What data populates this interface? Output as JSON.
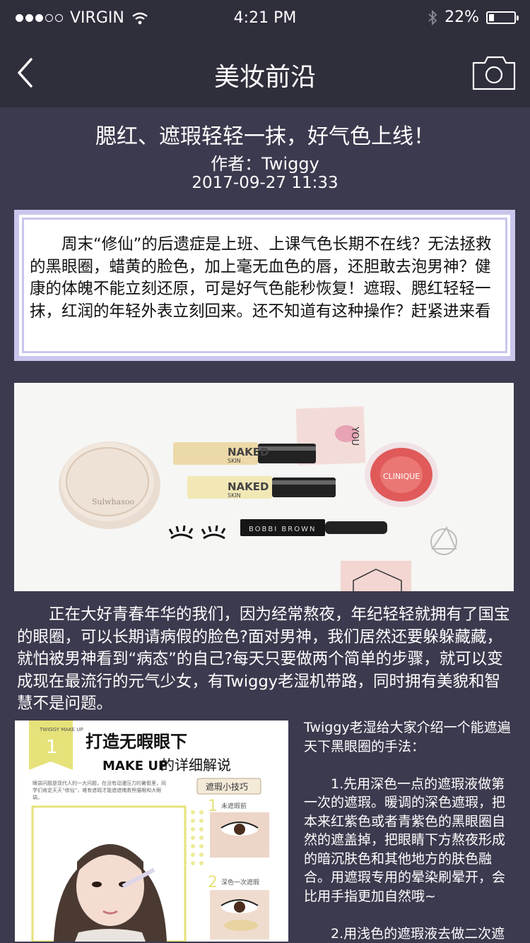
{
  "status_bar": {
    "carrier": "VIRGIN",
    "time": "4:21 PM",
    "battery": "22%",
    "battery_level": 0.22,
    "signal_bars_filled": 3,
    "signal_bars_total": 5,
    "icons": [
      "wifi-icon",
      "bluetooth-icon",
      "battery-icon"
    ]
  },
  "nav": {
    "title": "美妆前沿",
    "back_icon": "chevron-left-icon",
    "camera_icon": "camera-icon"
  },
  "article": {
    "title": "腮红、遮瑕轻轻一抹，好气色上线！",
    "author": "作者：Twiggy",
    "date": "2017-09-27 11:33",
    "intro": "周末“修仙”的后遗症是上班、上课气色长期不在线？无法拯救的黑眼圈，蜡黄的脸色，加上毫无血色的唇，还胆敢去泡男神？健康的体魄不能立刻还原，可是好气色能秒恢复！遮瑕、腮红轻轻一抹，红润的年轻外表立刻回来。还不知道有这种操作？赶紧进来看",
    "hero_image": {
      "cushion_brand": "Sulwhasoo",
      "concealer_brand_1": "NAKED",
      "concealer_brand_1_sub": "SKIN",
      "concealer_brand_2": "NAKED",
      "concealer_brand_2_sub": "SKIN",
      "mascara_brand": "BOBBI BROWN",
      "blush_brand": "CLINIQUE",
      "card_text": "YOU"
    },
    "paragraph2": "正在大好青春年华的我们，因为经常熬夜，年纪轻轻就拥有了国宝的眼圈，可以长期请病假的脸色?面对男神，我们居然还要躲躲藏藏，就怕被男神看到“病态”的自己?每天只要做两个简单的步骤，就可以变成现在最流行的元气少女，有Twiggy老湿机带路，同时拥有美貌和智慧不是问题。",
    "guide_image": {
      "badge_label": "TWIGGY MAKE UP",
      "badge_number": "1",
      "heading": "打造无暇眼下",
      "subheading_bold": "MAKE UP",
      "subheading": "的详细解说",
      "tips_label": "遮瑕小技巧",
      "step1_num": "1",
      "step1_label": "未遮瑕前",
      "step2_num": "2",
      "step2_label": "深色一次遮瑕",
      "body_text": "眼袋问题是现代人的一大问题，在没有动漫压力的暑假里，同学们肯定天天“修仙”，难有遮瑕才能遮遮掩救熊猫眼和大眼袋。"
    },
    "side_text": {
      "intro": "Twiggy老湿给大家介绍一个能遮遍天下黑眼圈的手法：",
      "step1": "1.先用深色一点的遮瑕液做第一次的遮瑕。暖调的深色遮瑕，把本来红紫色或者青紫色的黑眼圈自然的遮盖掉，把眼睛下方熬夜形成的暗沉肤色和其他地方的肤色融合。用遮瑕专用的晕染刷晕开，会比用手指更加自然哦~",
      "step2": "2.用浅色的遮瑕液去做二次遮"
    }
  },
  "colors": {
    "background": "#3c3a4e",
    "bar": "#2f2e3b",
    "intro_border": "#c9c6ec",
    "badge_yellow": "#e6e27a",
    "blush": "#e05a5a"
  }
}
